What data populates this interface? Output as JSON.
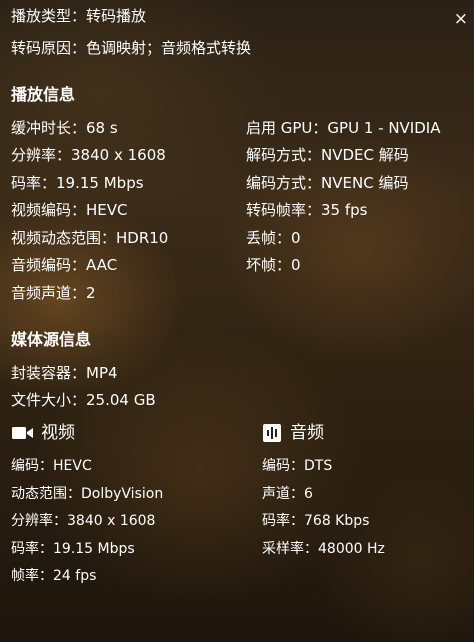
{
  "playback": {
    "type_label": "播放类型：",
    "type_value": "转码播放",
    "reason_label": "转码原因：",
    "reason_value": "色调映射；音频格式转换"
  },
  "close_symbol": "×",
  "play_info": {
    "title": "播放信息",
    "left": [
      {
        "label": "缓冲时长：",
        "value": "68 s"
      },
      {
        "label": "分辨率：",
        "value": "3840 x 1608"
      },
      {
        "label": "码率：",
        "value": "19.15 Mbps"
      },
      {
        "label": "视频编码：",
        "value": "HEVC"
      },
      {
        "label": "视频动态范围：",
        "value": "HDR10"
      },
      {
        "label": "音频编码：",
        "value": "AAC"
      },
      {
        "label": "音频声道：",
        "value": "2"
      }
    ],
    "right": [
      {
        "label": "启用 GPU：",
        "value": "GPU 1 - NVIDIA"
      },
      {
        "label": "解码方式：",
        "value": "NVDEC 解码"
      },
      {
        "label": "编码方式：",
        "value": "NVENC 编码"
      },
      {
        "label": "转码帧率：",
        "value": "35 fps"
      },
      {
        "label": "丢帧：",
        "value": "0"
      },
      {
        "label": "坏帧：",
        "value": "0"
      }
    ]
  },
  "media_info": {
    "title": "媒体源信息",
    "container_label": "封装容器：",
    "container_value": "MP4",
    "size_label": "文件大小：",
    "size_value": "25.04 GB",
    "video": {
      "title": "视频",
      "icon": "video-camera-icon",
      "rows": [
        {
          "label": "编码：",
          "value": "HEVC"
        },
        {
          "label": "动态范围：",
          "value": "DolbyVision"
        },
        {
          "label": "分辨率：",
          "value": "3840 x 1608"
        },
        {
          "label": "码率：",
          "value": "19.15 Mbps"
        },
        {
          "label": "帧率：",
          "value": "24 fps"
        }
      ]
    },
    "audio": {
      "title": "音频",
      "icon": "audio-waveform-icon",
      "rows": [
        {
          "label": "编码：",
          "value": "DTS"
        },
        {
          "label": "声道：",
          "value": "6"
        },
        {
          "label": "码率：",
          "value": "768 Kbps"
        },
        {
          "label": "采样率：",
          "value": "48000 Hz"
        }
      ]
    }
  }
}
